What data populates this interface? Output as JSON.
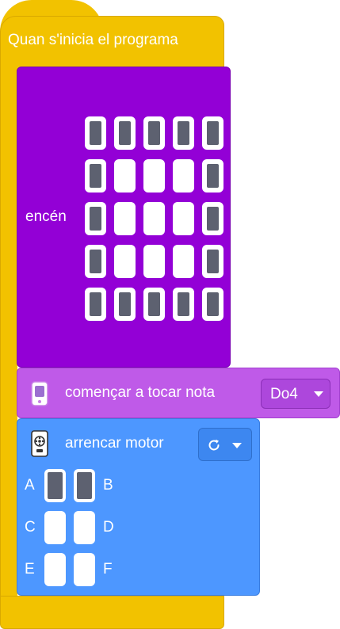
{
  "event_block": {
    "label": "Quan s'inicia el programa",
    "color": "#f2c200"
  },
  "led_block": {
    "label": "encén",
    "color": "#9300d6",
    "grid": [
      [
        1,
        1,
        1,
        1,
        1
      ],
      [
        1,
        0,
        0,
        0,
        1
      ],
      [
        1,
        0,
        0,
        0,
        1
      ],
      [
        1,
        0,
        0,
        0,
        1
      ],
      [
        1,
        1,
        1,
        1,
        1
      ]
    ]
  },
  "sound_block": {
    "icon": "speaker-icon",
    "label": "començar a tocar nota",
    "note": "Do4",
    "color": "#bf5ae8"
  },
  "motor_block": {
    "icon": "motor-icon",
    "label": "arrencar motor",
    "direction_icon": "clockwise-icon",
    "color": "#4d97ff",
    "ports": [
      {
        "left_label": "A",
        "right_label": "B",
        "left_on": true,
        "right_on": true
      },
      {
        "left_label": "C",
        "right_label": "D",
        "left_on": false,
        "right_on": false
      },
      {
        "left_label": "E",
        "right_label": "F",
        "left_on": false,
        "right_on": false
      }
    ]
  }
}
